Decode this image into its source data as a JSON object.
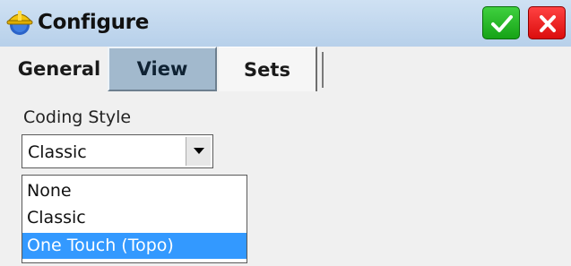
{
  "window": {
    "title": "Configure",
    "app_icon": "hardhat-icon",
    "ok_icon": "checkmark-icon",
    "close_icon": "close-icon"
  },
  "tabs": [
    {
      "label": "General",
      "active": false
    },
    {
      "label": "View",
      "active": true
    },
    {
      "label": "Sets",
      "active": false
    }
  ],
  "coding_style": {
    "label": "Coding Style",
    "selected": "Classic",
    "options": [
      "None",
      "Classic",
      "One Touch (Topo)"
    ],
    "highlighted_option": "One Touch (Topo)",
    "arrow_icon": "dropdown-arrow-icon"
  },
  "colors": {
    "ok_green": "#22b822",
    "close_red": "#ee1c1c",
    "active_tab": "#a2b9cd",
    "highlight": "#3399ff"
  }
}
